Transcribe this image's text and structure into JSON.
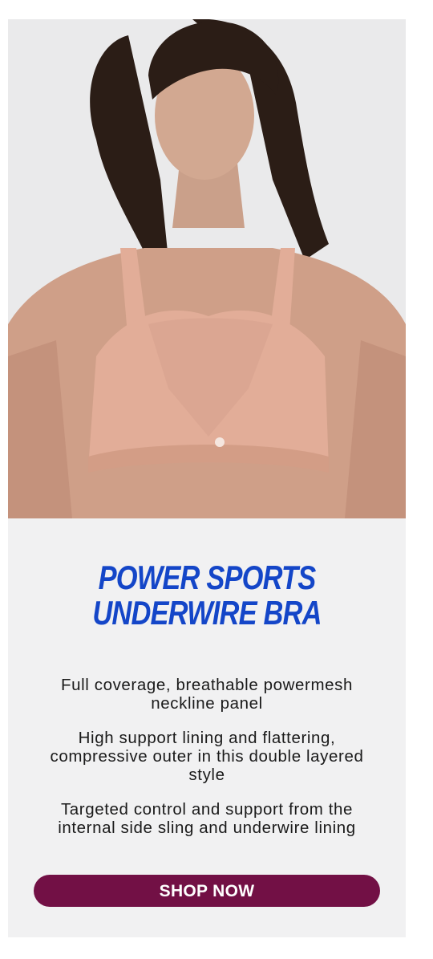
{
  "product": {
    "title_line_1": "POWER SPORTS",
    "title_line_2": "UNDERWIRE BRA",
    "image_alt": "Model wearing a blush pink sports bra",
    "features": [
      "Full coverage, breathable powermesh neckline panel",
      "High support lining and flattering, compressive outer in this double layered style",
      "Targeted control and support from the internal side sling and underwire lining"
    ],
    "cta_label": "SHOP NOW"
  },
  "colors": {
    "title": "#1446c8",
    "button": "#721045",
    "panel": "#f1f1f2",
    "garment": "#e2ad98"
  }
}
